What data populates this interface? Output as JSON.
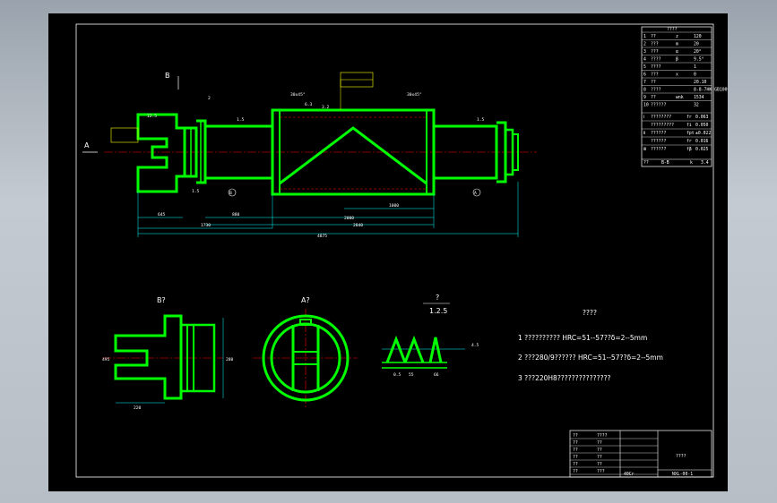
{
  "drawing": {
    "views": {
      "b_arrow": "B",
      "a_arrow": "A",
      "section_b_label": "B?",
      "section_a_label": "A?",
      "detail_label": "?",
      "detail_scale": "1.2.5",
      "datum_a": "A",
      "datum_b": "B"
    },
    "notes": {
      "heading": "????",
      "lines": [
        "1  ??????????  HRC=51--57??δ=2--5mm",
        "2  ???280/9??????  HRC=51--57??δ=2--5mm",
        "3  ???220H8???????????????"
      ]
    },
    "dims": {
      "d645": "645",
      "d880": "880",
      "d2000": "2000",
      "d1000": "1000",
      "d1730": "1730",
      "d2840": "2840",
      "d4875": "4875",
      "d15a": "1.5",
      "d15b": "1.5",
      "d15c": "1.5",
      "d63": "6.3",
      "d125": "12.5",
      "d32": "3.2",
      "d30x45a": "30x45°",
      "d30x45b": "30x45°",
      "dimB1": "220",
      "dimB2": "280",
      "dimB3": "495",
      "dimD1": "0.5",
      "dimD2": "55",
      "dimD3": "66",
      "dimD4": "4.5",
      "dim280": "280",
      "dim220": "220"
    },
    "params_table": {
      "title": "????",
      "rows": [
        [
          "1",
          "??",
          "z",
          "120"
        ],
        [
          "2",
          "???",
          "m",
          "20"
        ],
        [
          "3",
          "???",
          "α",
          "20°"
        ],
        [
          "4",
          "????",
          "β",
          "9.5°"
        ],
        [
          "5",
          "????",
          "",
          "1"
        ],
        [
          "6",
          "???",
          "x",
          "0"
        ],
        [
          "7",
          "??",
          "",
          "20.10"
        ],
        [
          "8",
          "????",
          "",
          "8-8-7HK GB10095-88"
        ],
        [
          "9",
          "??",
          "wnk",
          "1534"
        ],
        [
          "10",
          "??????",
          "",
          "32"
        ]
      ],
      "tol_rows": [
        [
          "Ⅰ",
          "????????",
          "fr",
          "0.063"
        ],
        [
          "",
          "?????????",
          "fi",
          "0.050"
        ],
        [
          "Ⅱ",
          "??????",
          "fpt",
          "±0.022"
        ],
        [
          "",
          "??????",
          "fr",
          "0.016"
        ],
        [
          "Ⅲ",
          "??????",
          "fβ",
          "0.025"
        ]
      ],
      "foot": [
        "??",
        "?????",
        "B-B",
        "k",
        "3.4"
      ]
    },
    "title_block": {
      "rows": [
        [
          "??",
          "????"
        ],
        [
          "??",
          "??"
        ],
        [
          "??",
          "??"
        ],
        [
          "??",
          "??"
        ],
        [
          "??",
          "??"
        ],
        [
          "??",
          "???"
        ]
      ],
      "part_name": "????",
      "drawing_no": "NXL-00-1",
      "material": "40Cr"
    },
    "colors": {
      "outline": "#00ff00",
      "centerline": "#ff0000",
      "dimension": "#00ffff",
      "text": "#ffffff",
      "leader": "#ffff00"
    }
  }
}
